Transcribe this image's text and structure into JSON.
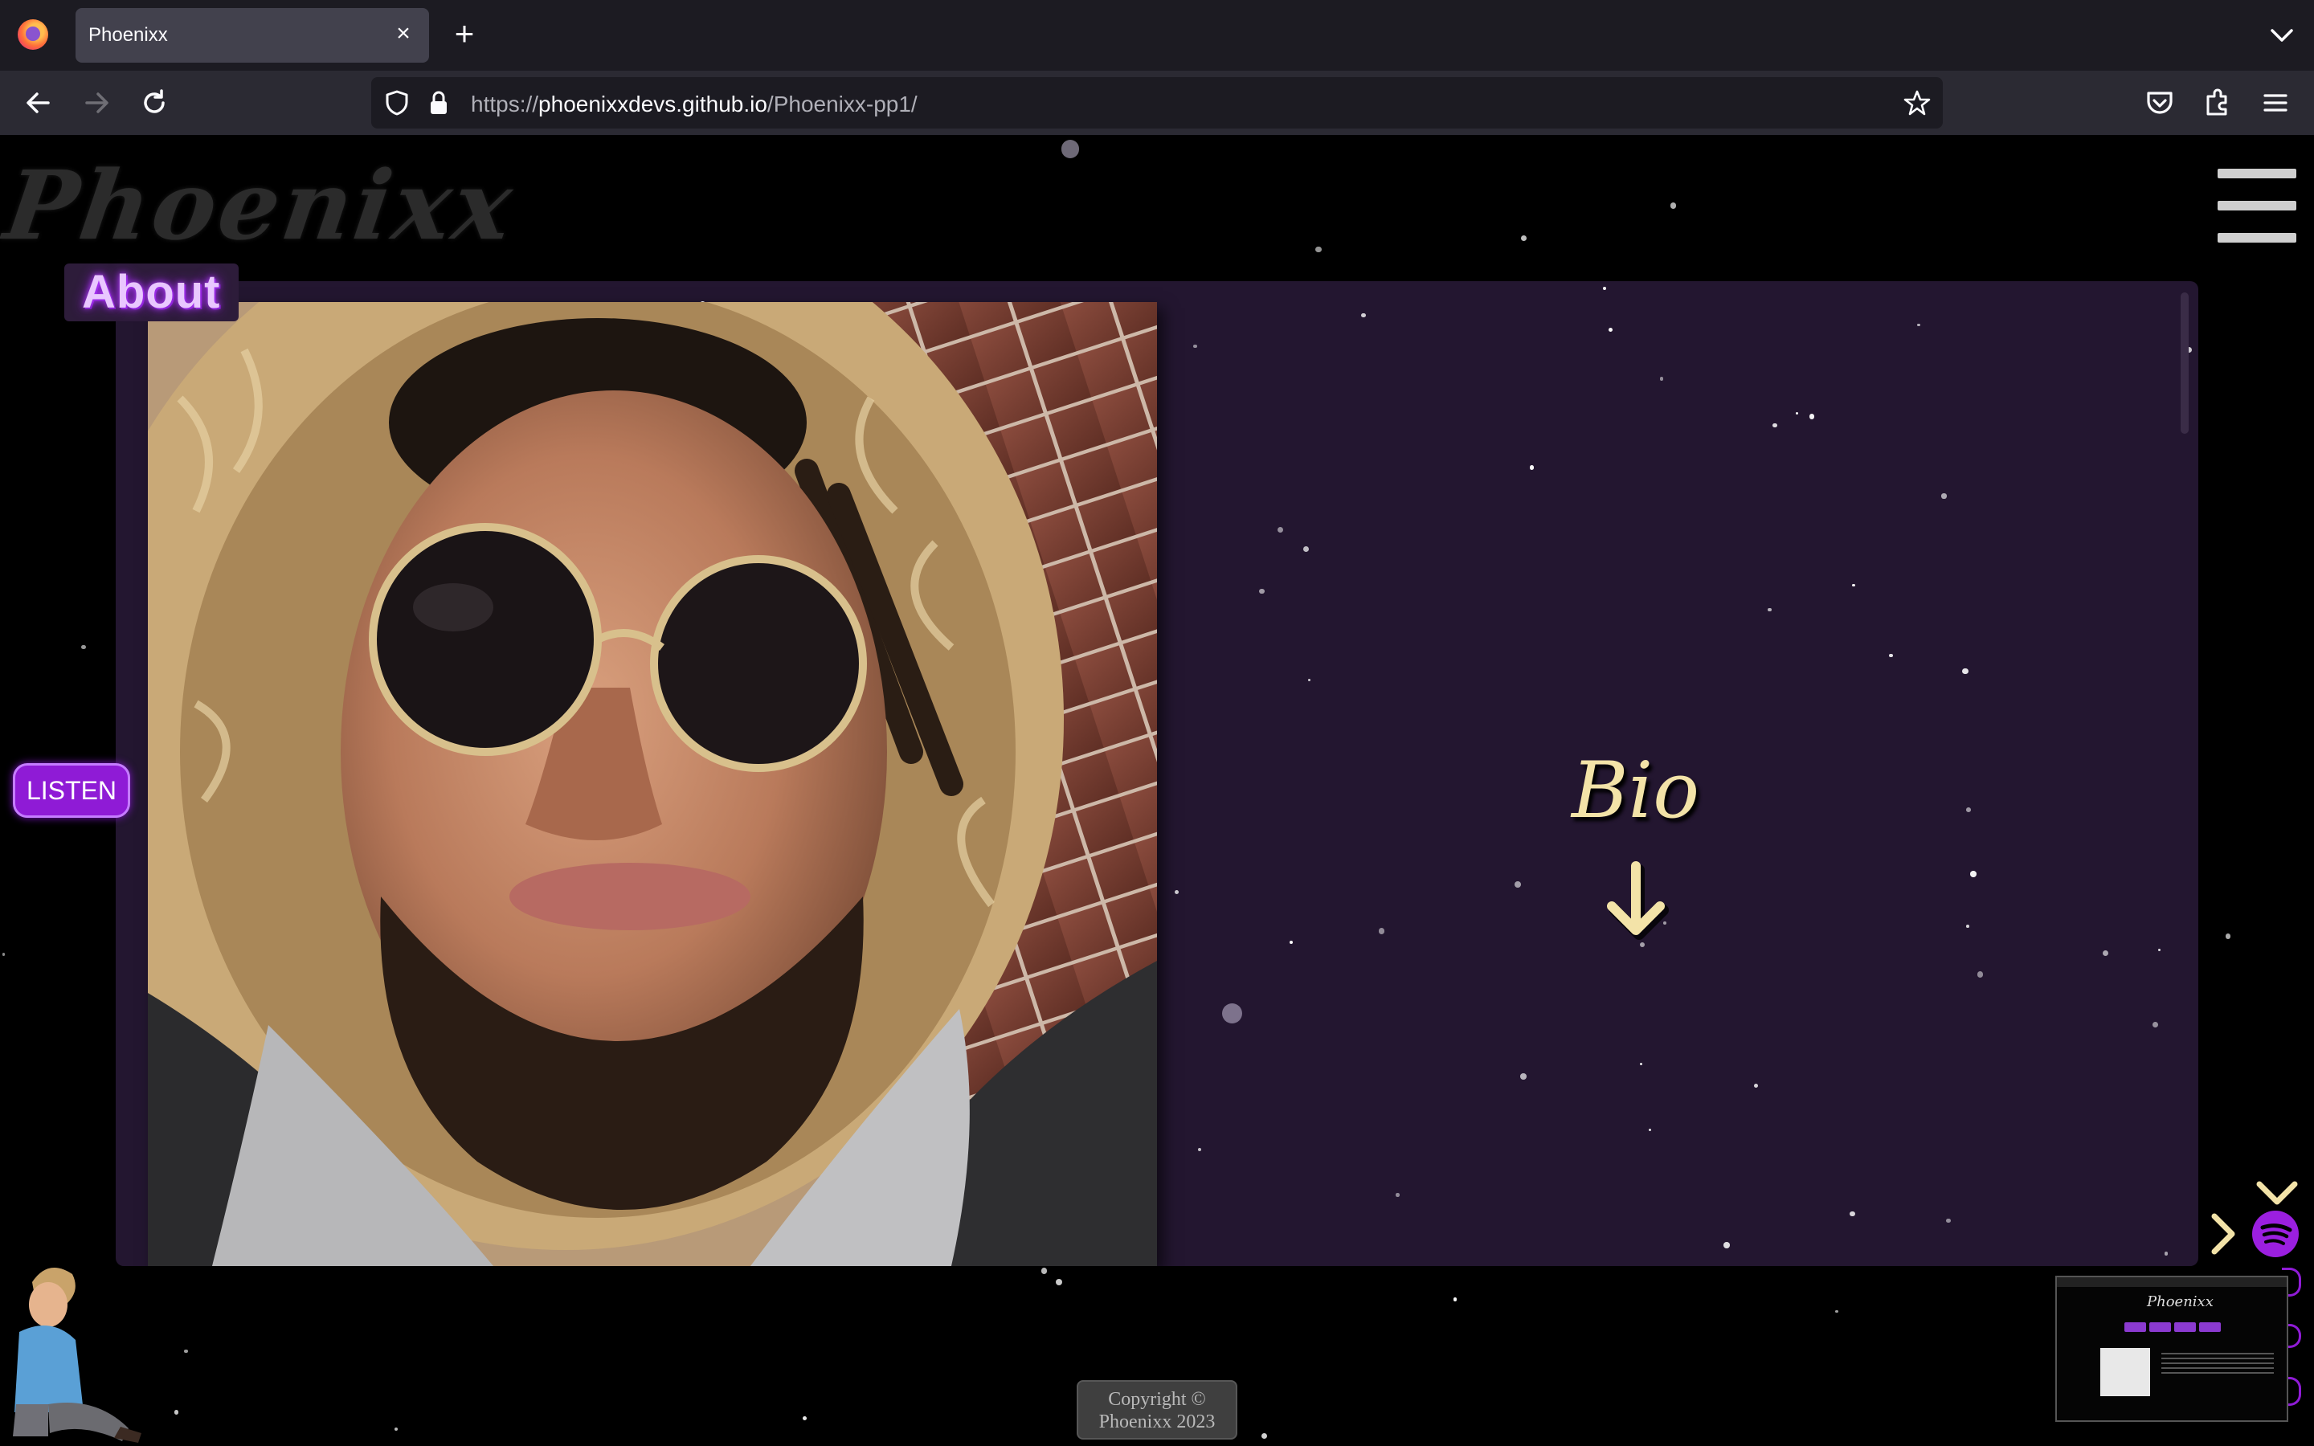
{
  "browser": {
    "tab_title": "Phoenixx",
    "tab_close_glyph": "×",
    "new_tab_glyph": "+",
    "url_scheme": "https://",
    "url_host": "phoenixxdevs.github.io",
    "url_path": "/Phoenixx-pp1/",
    "icons": [
      "firefox-icon",
      "close-icon",
      "plus-icon",
      "chevron-down-icon",
      "back-arrow-icon",
      "forward-arrow-icon",
      "reload-icon",
      "shield-icon",
      "lock-icon",
      "star-icon",
      "pocket-icon",
      "extensions-icon",
      "menu-icon"
    ]
  },
  "page": {
    "logo_text": "Phoenixx",
    "section_title": "About",
    "bio_label": "Bio",
    "listen_button": "LISTEN",
    "copyright_line1": "Copyright ©",
    "copyright_line2": "Phoenixx 2023",
    "icons": [
      "hamburger-menu-icon",
      "arrow-down-icon",
      "chevron-down-icon",
      "chevron-right-icon",
      "spotify-icon"
    ]
  },
  "colors": {
    "panel_bg": "#231630",
    "accent_purple": "#8f1bd6",
    "bio_gold": "#f3e3a8",
    "about_glow": "#b13cff"
  }
}
